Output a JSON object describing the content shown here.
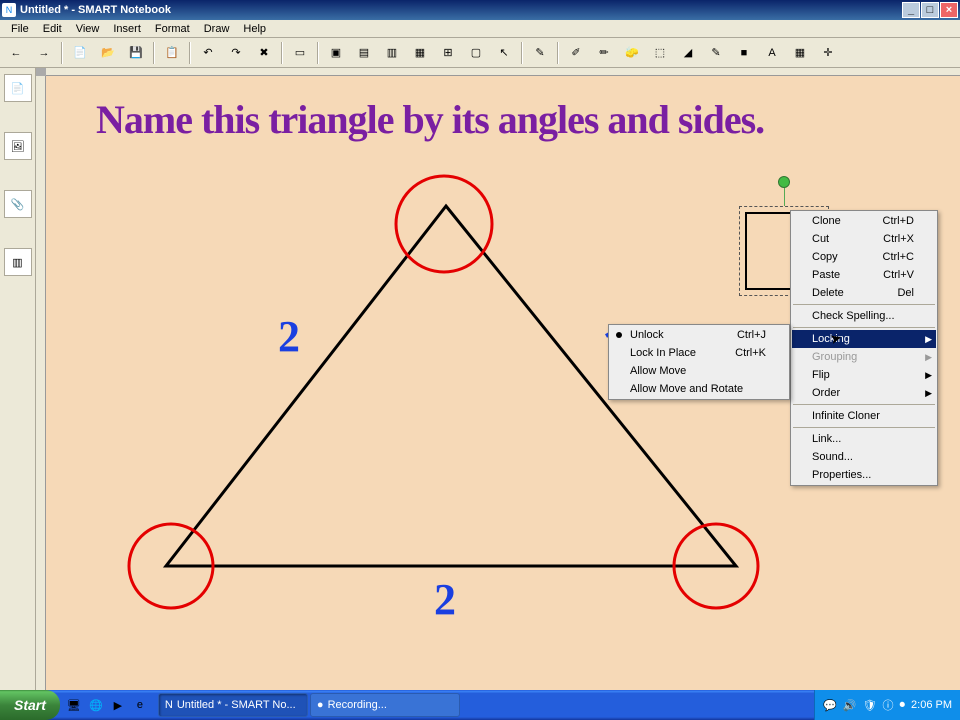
{
  "window": {
    "title": "Untitled * - SMART Notebook",
    "app_icon": "N"
  },
  "menu": [
    "File",
    "Edit",
    "View",
    "Insert",
    "Format",
    "Draw",
    "Help"
  ],
  "toolbar_icons": [
    "←",
    "→",
    "📄",
    "📂",
    "💾",
    "📋",
    "↶",
    "↷",
    "✖",
    "▭",
    "▣",
    "▤",
    "▥",
    "▦",
    "⊞",
    "▢",
    "↖",
    "✎",
    "✐",
    "✏",
    "🧽",
    "⬚",
    "◢",
    "✎",
    "■",
    "A",
    "▦",
    "✛"
  ],
  "leftpanel": [
    "📄",
    "🖼",
    "📎",
    "▥"
  ],
  "canvas": {
    "prompt": "Name this triangle by its angles and sides.",
    "labels": {
      "left": "2",
      "right": "2",
      "bottom": "2"
    }
  },
  "context_menu": {
    "items": [
      {
        "label": "Clone",
        "shortcut": "Ctrl+D"
      },
      {
        "label": "Cut",
        "shortcut": "Ctrl+X"
      },
      {
        "label": "Copy",
        "shortcut": "Ctrl+C"
      },
      {
        "label": "Paste",
        "shortcut": "Ctrl+V"
      },
      {
        "label": "Delete",
        "shortcut": "Del"
      },
      {
        "sep": true
      },
      {
        "label": "Check Spelling..."
      },
      {
        "sep": true
      },
      {
        "label": "Locking",
        "submenu": true,
        "highlight": true
      },
      {
        "label": "Grouping",
        "submenu": true,
        "disabled": true
      },
      {
        "label": "Flip",
        "submenu": true
      },
      {
        "label": "Order",
        "submenu": true
      },
      {
        "sep": true
      },
      {
        "label": "Infinite Cloner"
      },
      {
        "sep": true
      },
      {
        "label": "Link..."
      },
      {
        "label": "Sound..."
      },
      {
        "label": "Properties..."
      }
    ]
  },
  "locking_submenu": [
    {
      "label": "Unlock",
      "shortcut": "Ctrl+J",
      "dot": true
    },
    {
      "label": "Lock In Place",
      "shortcut": "Ctrl+K"
    },
    {
      "label": "Allow Move"
    },
    {
      "label": "Allow Move and Rotate"
    }
  ],
  "taskbar": {
    "start": "Start",
    "tasks": [
      {
        "label": "Untitled * - SMART No...",
        "active": true,
        "icon": "N"
      },
      {
        "label": "Recording...",
        "active": false,
        "icon": "●"
      }
    ],
    "time": "2:06 PM"
  }
}
